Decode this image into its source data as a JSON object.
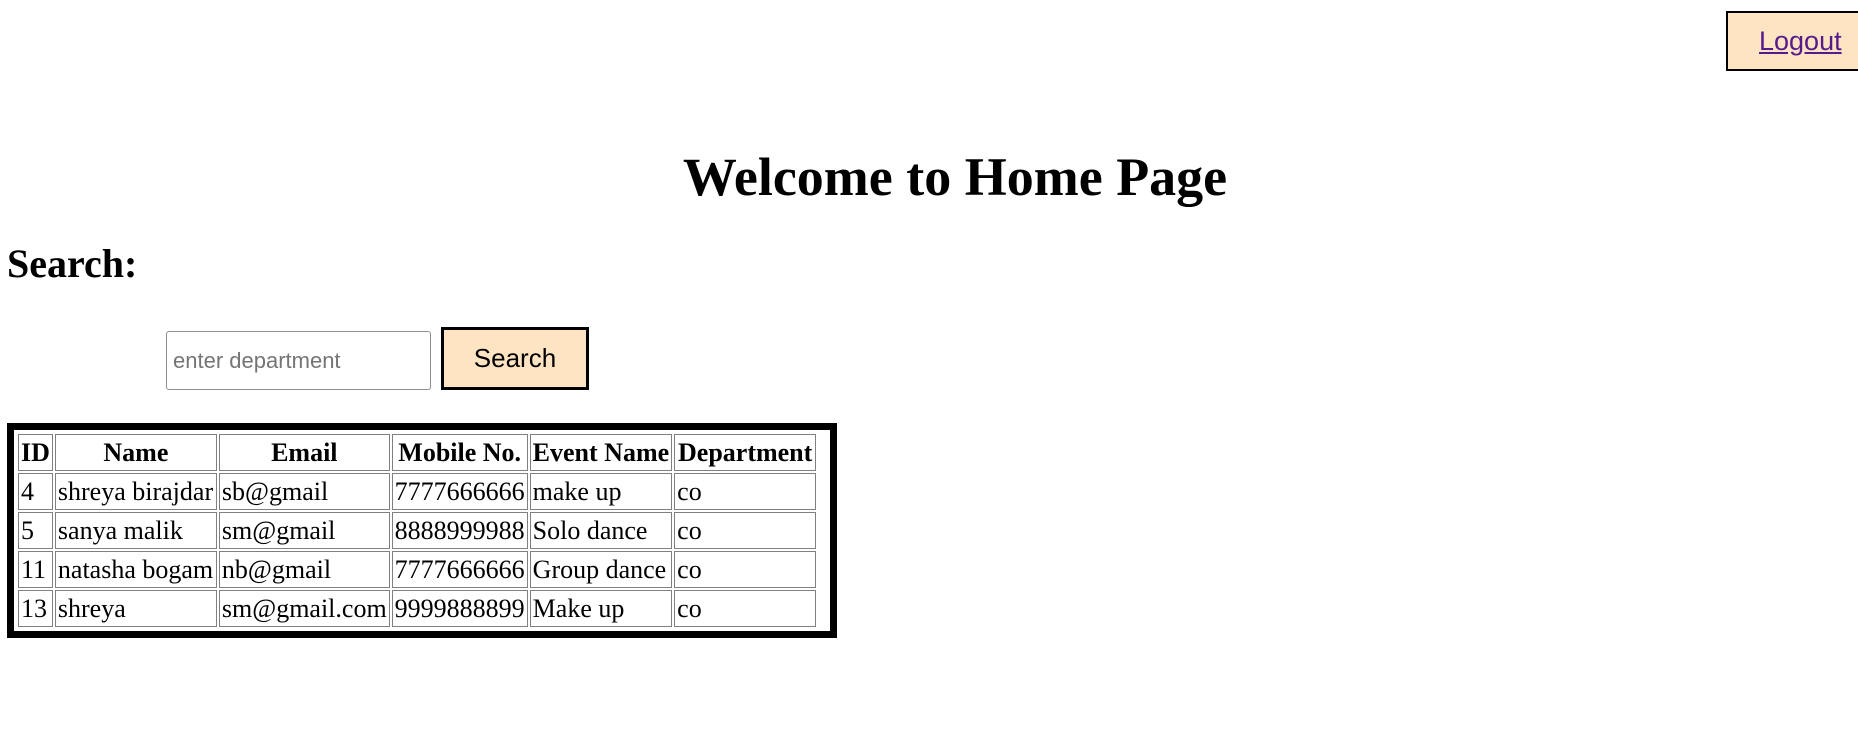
{
  "header": {
    "logout_label": "Logout"
  },
  "main": {
    "title": "Welcome to Home Page",
    "search_heading": "Search:",
    "search_placeholder": "enter department",
    "search_value": "",
    "search_button_label": "Search"
  },
  "table": {
    "columns": [
      "ID",
      "Name",
      "Email",
      "Mobile No.",
      "Event Name",
      "Department"
    ],
    "rows": [
      [
        "4",
        "shreya birajdar",
        "sb@gmail",
        "7777666666",
        "make up",
        "co"
      ],
      [
        "5",
        "sanya malik",
        "sm@gmail",
        "8888999988",
        "Solo dance",
        "co"
      ],
      [
        "11",
        "natasha bogam",
        "nb@gmail",
        "7777666666",
        "Group dance",
        "co"
      ],
      [
        "13",
        "shreya",
        "sm@gmail.com",
        "9999888899",
        "Make up",
        "co"
      ]
    ]
  },
  "colors": {
    "button_background": "#ffe4c4",
    "link": "#551a8b",
    "border": "#000000"
  }
}
